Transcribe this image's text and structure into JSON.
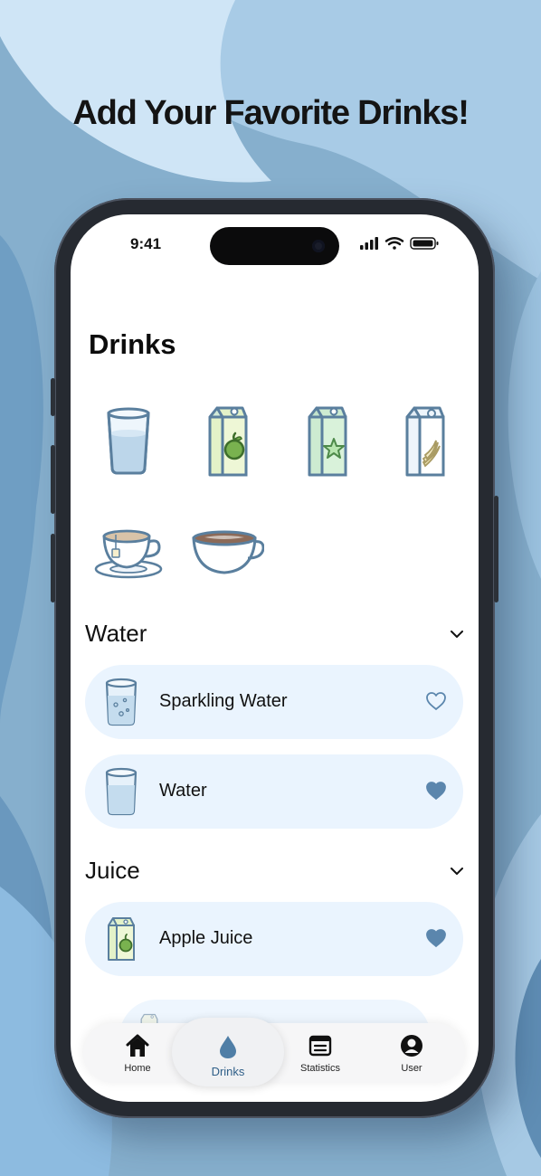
{
  "headline": "Add Your Favorite Drinks!",
  "status_bar": {
    "time": "9:41"
  },
  "page": {
    "title": "Drinks"
  },
  "drink_picker": [
    {
      "icon": "water-glass-icon"
    },
    {
      "icon": "apple-juice-carton-icon"
    },
    {
      "icon": "star-juice-carton-icon"
    },
    {
      "icon": "banana-milk-carton-icon"
    },
    {
      "icon": "tea-cup-icon"
    },
    {
      "icon": "coffee-cup-icon"
    }
  ],
  "sections": [
    {
      "title": "Water",
      "items": [
        {
          "name": "Sparkling Water",
          "favorite": false
        },
        {
          "name": "Water",
          "favorite": true
        }
      ]
    },
    {
      "title": "Juice",
      "items": [
        {
          "name": "Apple Juice",
          "favorite": true
        }
      ]
    }
  ],
  "tabs": [
    {
      "label": "Home",
      "icon": "home-icon",
      "active": false
    },
    {
      "label": "Drinks",
      "icon": "water-drop-icon",
      "active": true
    },
    {
      "label": "Statistics",
      "icon": "statistics-icon",
      "active": false
    },
    {
      "label": "User",
      "icon": "user-icon",
      "active": false
    }
  ],
  "colors": {
    "accent": "#5b86ad",
    "card_background": "#eaf4fe",
    "outline": "#5a7f9e",
    "background": "#7fa9c9"
  }
}
